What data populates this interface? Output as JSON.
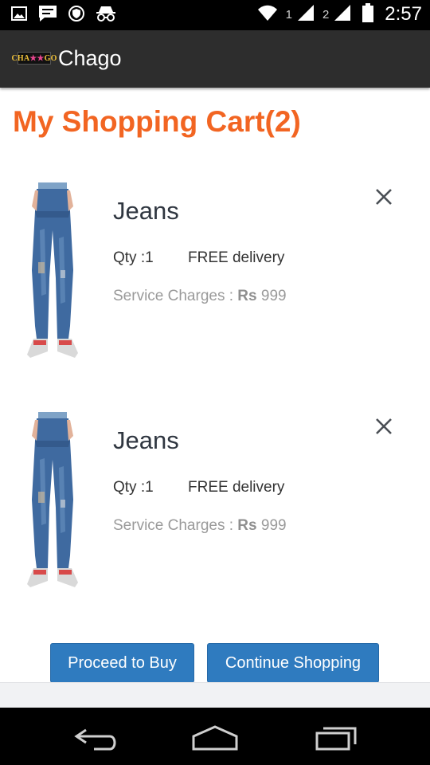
{
  "status_bar": {
    "time": "2:57",
    "sim1": "1",
    "sim2": "2",
    "icons": [
      "image-icon",
      "chat-icon",
      "shield-icon",
      "incognito-icon",
      "wifi-icon",
      "signal-icon",
      "battery-icon"
    ]
  },
  "app_bar": {
    "logo_text_left": "CHA",
    "logo_text_mid": "★★",
    "logo_text_right": "GO",
    "title": "Chago"
  },
  "cart": {
    "title": "My Shopping Cart(2)",
    "items": [
      {
        "name": "Jeans",
        "qty": "Qty :1",
        "delivery": "FREE delivery",
        "service_label": "Service Charges : ",
        "currency": "Rs",
        "price": " 999"
      },
      {
        "name": "Jeans",
        "qty": "Qty :1",
        "delivery": "FREE delivery",
        "service_label": "Service Charges : ",
        "currency": "Rs",
        "price": " 999"
      }
    ]
  },
  "actions": {
    "proceed": "Proceed to Buy",
    "continue": "Continue Shopping"
  },
  "colors": {
    "accent": "#f26522",
    "button": "#2f7bbf",
    "app_bar": "#2d2d2d"
  },
  "nav": {
    "icons": [
      "back-icon",
      "home-icon",
      "recents-icon"
    ]
  }
}
